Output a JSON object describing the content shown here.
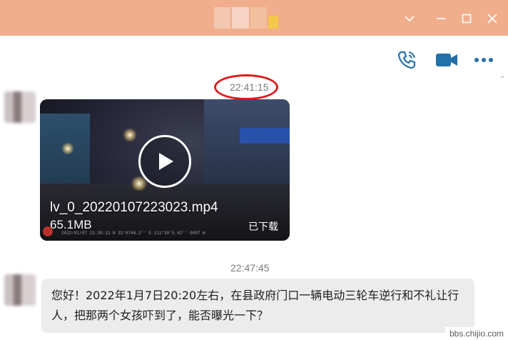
{
  "colors": {
    "titlebar": "#f0ae8d",
    "accent": "#2470a8",
    "highlight_circle": "#e11a1a",
    "bubble": "#ececec"
  },
  "window": {
    "controls": [
      "chevron-down-icon",
      "maximize-icon",
      "close-icon"
    ]
  },
  "chat_actions": [
    "voice-call-icon",
    "video-call-icon",
    "more-icon"
  ],
  "messages": {
    "first_timestamp": "22:41:15",
    "video": {
      "filename": "lv_0_20220107223023.mp4",
      "size": "65.1MB",
      "status": "已下载",
      "overlay_text": "2022/01/07 22:30:12   N 31°0746.2''   E 111°38'5.42''    0097 m"
    },
    "second_timestamp": "22:47:45",
    "text_message": "您好！2022年1月7日20:20左右，在县政府门口一辆电动三轮车逆行和不礼让行人，把那两个女孩吓到了，能否曝光一下？"
  },
  "watermark": "bbs.chijio.com"
}
